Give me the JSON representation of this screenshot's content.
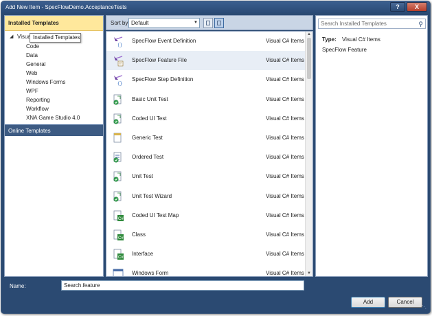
{
  "window": {
    "title": "Add New Item - SpecFlowDemo.AcceptanceTests",
    "help_label": "?",
    "close_label": "X"
  },
  "left": {
    "header": "Installed Templates",
    "root": "Visual C# Items",
    "root_visible": "Visual",
    "tooltip": "Installed Templates",
    "children": [
      "Code",
      "Data",
      "General",
      "Web",
      "Windows Forms",
      "WPF",
      "Reporting",
      "Workflow",
      "XNA Game Studio 4.0"
    ],
    "online": "Online Templates"
  },
  "toolbar": {
    "sort_label": "Sort by:",
    "sort_value": "Default"
  },
  "templates": [
    {
      "name": "SpecFlow Event Definition",
      "category": "Visual C# Items",
      "icon": "specflow-event-icon"
    },
    {
      "name": "SpecFlow Feature File",
      "category": "Visual C# Items",
      "icon": "specflow-feature-icon",
      "selected": true
    },
    {
      "name": "SpecFlow Step Definition",
      "category": "Visual C# Items",
      "icon": "specflow-step-icon"
    },
    {
      "name": "Basic Unit Test",
      "category": "Visual C# Items",
      "icon": "unit-test-icon"
    },
    {
      "name": "Coded UI Test",
      "category": "Visual C# Items",
      "icon": "coded-ui-test-icon"
    },
    {
      "name": "Generic Test",
      "category": "Visual C# Items",
      "icon": "generic-test-icon"
    },
    {
      "name": "Ordered Test",
      "category": "Visual C# Items",
      "icon": "ordered-test-icon"
    },
    {
      "name": "Unit Test",
      "category": "Visual C# Items",
      "icon": "unit-test-icon"
    },
    {
      "name": "Unit Test Wizard",
      "category": "Visual C# Items",
      "icon": "unit-test-wizard-icon"
    },
    {
      "name": "Coded UI Test Map",
      "category": "Visual C# Items",
      "icon": "ui-test-map-icon"
    },
    {
      "name": "Class",
      "category": "Visual C# Items",
      "icon": "class-icon"
    },
    {
      "name": "Interface",
      "category": "Visual C# Items",
      "icon": "interface-icon"
    },
    {
      "name": "Windows Form",
      "category": "Visual C# Items",
      "icon": "windows-form-icon"
    }
  ],
  "right": {
    "search_placeholder": "Search Installed Templates",
    "type_label": "Type:",
    "type_value": "Visual C# Items",
    "description": "SpecFlow Feature"
  },
  "bottom": {
    "name_label": "Name:",
    "name_value": "Search.feature",
    "add_label": "Add",
    "cancel_label": "Cancel"
  }
}
